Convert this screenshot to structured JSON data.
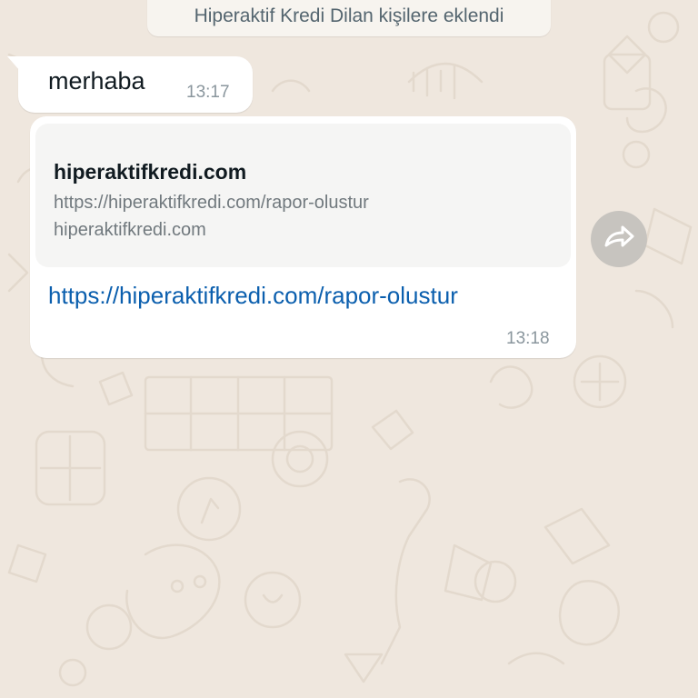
{
  "system_notice": {
    "text": "Hiperaktif Kredi Dilan kişilere eklendi"
  },
  "messages": [
    {
      "type": "text",
      "text": "merhaba",
      "time": "13:17"
    },
    {
      "type": "link",
      "preview": {
        "title": "hiperaktifkredi.com",
        "url": "https://hiperaktifkredi.com/rapor-olustur",
        "domain": "hiperaktifkredi.com"
      },
      "link_text": "https://hiperaktifkredi.com/rapor-olustur",
      "time": "13:18"
    }
  ],
  "icons": {
    "forward": "forward-icon"
  },
  "colors": {
    "wallpaper": "#efe7de",
    "bubble": "#ffffff",
    "link": "#0b5fae",
    "forward_button": "#c7c4bf"
  }
}
